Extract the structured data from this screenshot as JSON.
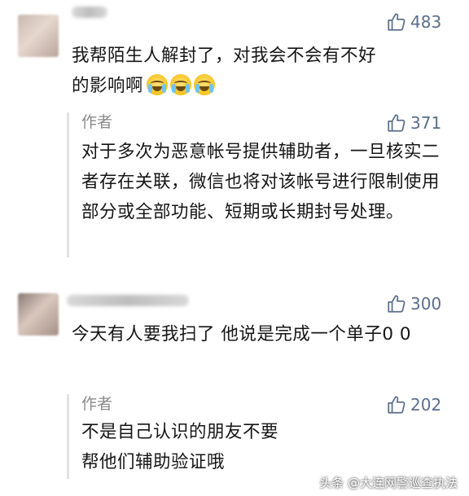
{
  "comments": [
    {
      "likes": "483",
      "text_line1": "我帮陌生人解封了，对我会不会有不好",
      "text_line2": "的影响啊",
      "emoji_name": "crying-face-icon",
      "reply": {
        "author_label": "作者",
        "likes": "371",
        "text": "对于多次为恶意帐号提供辅助者，一旦核实二者存在关联，微信也将对该帐号进行限制使用部分或全部功能、短期或长期封号处理。"
      }
    },
    {
      "likes": "300",
      "text": "今天有人要我扫了 他说是完成一个单子0 0",
      "reply": {
        "author_label": "作者",
        "likes": "202",
        "text": "不是自己认识的朋友不要帮他们辅助验证哦"
      }
    }
  ],
  "watermark": "头条 @大连网警巡查执法",
  "colors": {
    "like_icon": "#5a6e8c",
    "author_label": "#8a8a8a",
    "reply_bar": "#e2e2e2"
  }
}
